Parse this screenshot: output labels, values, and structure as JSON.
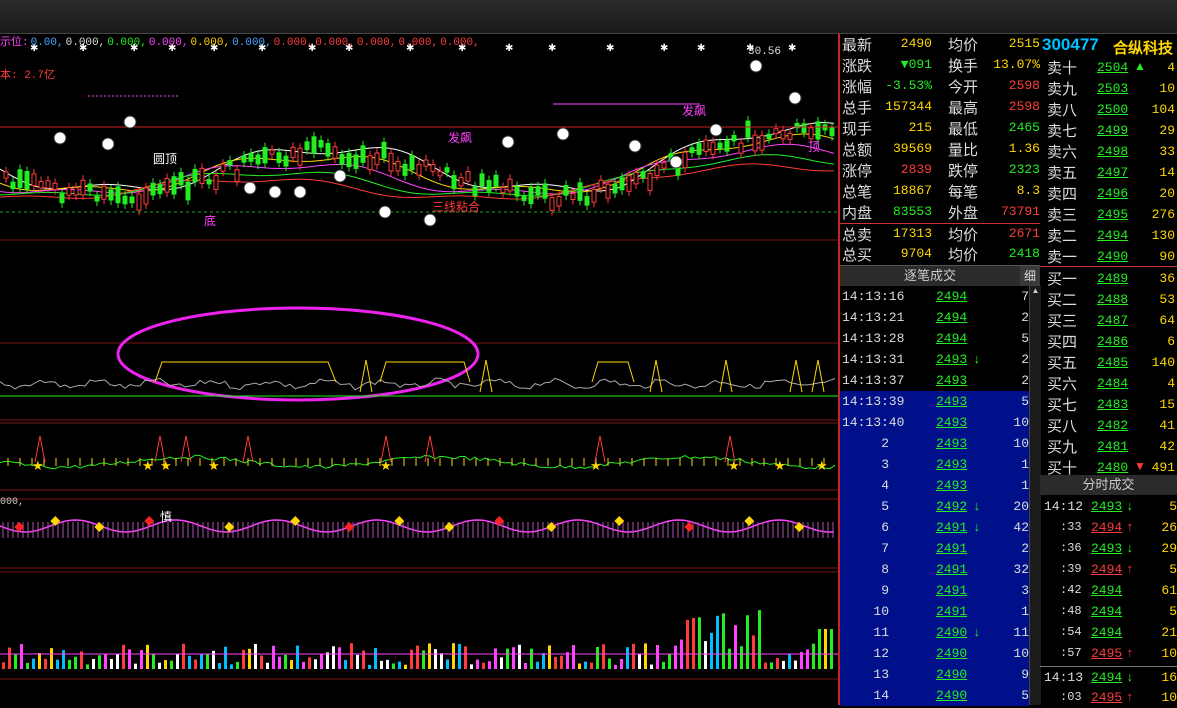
{
  "index_line": [
    {
      "t": "示位:",
      "c": "#ff44ff"
    },
    {
      "t": "0.00,",
      "c": "#4da3ff"
    },
    {
      "t": "0.000,",
      "c": "#ddd"
    },
    {
      "t": "0.000,",
      "c": "#22ee22"
    },
    {
      "t": "0.000,",
      "c": "#ff44ff"
    },
    {
      "t": "0.000,",
      "c": "#ffd700"
    },
    {
      "t": "0.000,",
      "c": "#4da3ff"
    },
    {
      "t": "0.000,",
      "c": "#ff3b3b"
    },
    {
      "t": "0.000,",
      "c": "#ff3b3b"
    },
    {
      "t": "0.000,",
      "c": "#ff3b3b"
    },
    {
      "t": "0.000,",
      "c": "#ff3b3b"
    },
    {
      "t": "0.000,",
      "c": "#ff3b3b"
    }
  ],
  "volume_label": "本: 2.7亿",
  "panel3_label": "000,",
  "price_label": "30.56",
  "annotations": [
    {
      "t": "圆顶",
      "c": "#ffffff"
    },
    {
      "t": "发飙",
      "c": "#ff44ff"
    },
    {
      "t": "发飙",
      "c": "#ff44ff"
    },
    {
      "t": "三线粘合",
      "c": "#ff3b3b"
    },
    {
      "t": "底",
      "c": "#ff44ff"
    },
    {
      "t": "顶",
      "c": "#ff44ff"
    },
    {
      "t": "慎",
      "c": "#ffffff"
    }
  ],
  "quote": {
    "rows": [
      {
        "l": "最新",
        "v": "2490",
        "vc": "#ffd700",
        "l2": "均价",
        "v2": "2515",
        "v2c": "#ffd700"
      },
      {
        "l": "涨跌",
        "v": "▼091",
        "vc": "#22ee22",
        "l2": "换手",
        "v2": "13.07%",
        "v2c": "#ffd700"
      },
      {
        "l": "涨幅",
        "v": "-3.53%",
        "vc": "#22ee22",
        "l2": "今开",
        "v2": "2598",
        "v2c": "#ff3b3b"
      },
      {
        "l": "总手",
        "v": "157344",
        "vc": "#ffd700",
        "l2": "最高",
        "v2": "2598",
        "v2c": "#ff3b3b"
      },
      {
        "l": "现手",
        "v": "215",
        "vc": "#ffd700",
        "l2": "最低",
        "v2": "2465",
        "v2c": "#22ee22"
      },
      {
        "l": "总额",
        "v": "39569",
        "vc": "#ffd700",
        "l2": "量比",
        "v2": "1.36",
        "v2c": "#ffd700"
      },
      {
        "l": "涨停",
        "v": "2839",
        "vc": "#ff3b3b",
        "l2": "跌停",
        "v2": "2323",
        "v2c": "#22ee22"
      },
      {
        "l": "总笔",
        "v": "18867",
        "vc": "#ffd700",
        "l2": "每笔",
        "v2": "8.3",
        "v2c": "#ffd700"
      },
      {
        "l": "内盘",
        "v": "83553",
        "vc": "#22ee22",
        "l2": "外盘",
        "v2": "73791",
        "v2c": "#ff3b3b"
      },
      {
        "l": "总卖",
        "v": "17313",
        "vc": "#ffd700",
        "l2": "均价",
        "v2": "2671",
        "v2c": "#ff3b3b"
      },
      {
        "l": "总买",
        "v": "9704",
        "vc": "#ffd700",
        "l2": "均价",
        "v2": "2418",
        "v2c": "#22ee22"
      }
    ]
  },
  "ticks": {
    "title": "逐笔成交",
    "btn": "细",
    "rows": [
      {
        "t": "14:13:16",
        "p": "2494",
        "pc": "#22ee22",
        "a": "",
        "v": "7"
      },
      {
        "t": "14:13:21",
        "p": "2494",
        "pc": "#22ee22",
        "a": "",
        "v": "2"
      },
      {
        "t": "14:13:28",
        "p": "2494",
        "pc": "#22ee22",
        "a": "",
        "v": "5"
      },
      {
        "t": "14:13:31",
        "p": "2493",
        "pc": "#22ee22",
        "a": "↓",
        "v": "2"
      },
      {
        "t": "14:13:37",
        "p": "2493",
        "pc": "#22ee22",
        "a": "",
        "v": "2"
      },
      {
        "t": "14:13:39",
        "p": "2493",
        "pc": "#22ee22",
        "a": "",
        "v": "5"
      },
      {
        "t": "14:13:40",
        "p": "2493",
        "pc": "#22ee22",
        "a": "",
        "v": "10"
      },
      {
        "t": "2",
        "p": "2493",
        "pc": "#22ee22",
        "a": "",
        "v": "10"
      },
      {
        "t": "3",
        "p": "2493",
        "pc": "#22ee22",
        "a": "",
        "v": "1"
      },
      {
        "t": "4",
        "p": "2493",
        "pc": "#22ee22",
        "a": "",
        "v": "1"
      },
      {
        "t": "5",
        "p": "2492",
        "pc": "#22ee22",
        "a": "↓",
        "v": "20"
      },
      {
        "t": "6",
        "p": "2491",
        "pc": "#22ee22",
        "a": "↓",
        "v": "42"
      },
      {
        "t": "7",
        "p": "2491",
        "pc": "#22ee22",
        "a": "",
        "v": "2"
      },
      {
        "t": "8",
        "p": "2491",
        "pc": "#22ee22",
        "a": "",
        "v": "32"
      },
      {
        "t": "9",
        "p": "2491",
        "pc": "#22ee22",
        "a": "",
        "v": "3"
      },
      {
        "t": "10",
        "p": "2491",
        "pc": "#22ee22",
        "a": "",
        "v": "1"
      },
      {
        "t": "11",
        "p": "2490",
        "pc": "#22ee22",
        "a": "↓",
        "v": "11"
      },
      {
        "t": "12",
        "p": "2490",
        "pc": "#22ee22",
        "a": "",
        "v": "10"
      },
      {
        "t": "13",
        "p": "2490",
        "pc": "#22ee22",
        "a": "",
        "v": "9"
      },
      {
        "t": "14",
        "p": "2490",
        "pc": "#22ee22",
        "a": "",
        "v": "5"
      }
    ]
  },
  "stock": {
    "code": "300477",
    "name": "合纵科技"
  },
  "book": [
    {
      "l": "卖十",
      "p": "2504",
      "pc": "#22ee22",
      "a": "▲",
      "v": "4"
    },
    {
      "l": "卖九",
      "p": "2503",
      "pc": "#22ee22",
      "a": "",
      "v": "10"
    },
    {
      "l": "卖八",
      "p": "2500",
      "pc": "#22ee22",
      "a": "",
      "v": "104"
    },
    {
      "l": "卖七",
      "p": "2499",
      "pc": "#22ee22",
      "a": "",
      "v": "29"
    },
    {
      "l": "卖六",
      "p": "2498",
      "pc": "#22ee22",
      "a": "",
      "v": "33"
    },
    {
      "l": "卖五",
      "p": "2497",
      "pc": "#22ee22",
      "a": "",
      "v": "14"
    },
    {
      "l": "卖四",
      "p": "2496",
      "pc": "#22ee22",
      "a": "",
      "v": "20"
    },
    {
      "l": "卖三",
      "p": "2495",
      "pc": "#22ee22",
      "a": "",
      "v": "276"
    },
    {
      "l": "卖二",
      "p": "2494",
      "pc": "#22ee22",
      "a": "",
      "v": "130"
    },
    {
      "l": "卖一",
      "p": "2490",
      "pc": "#22ee22",
      "a": "",
      "v": "90"
    },
    {
      "l": "买一",
      "p": "2489",
      "pc": "#22ee22",
      "a": "",
      "v": "36"
    },
    {
      "l": "买二",
      "p": "2488",
      "pc": "#22ee22",
      "a": "",
      "v": "53"
    },
    {
      "l": "买三",
      "p": "2487",
      "pc": "#22ee22",
      "a": "",
      "v": "64"
    },
    {
      "l": "买四",
      "p": "2486",
      "pc": "#22ee22",
      "a": "",
      "v": "6"
    },
    {
      "l": "买五",
      "p": "2485",
      "pc": "#22ee22",
      "a": "",
      "v": "140"
    },
    {
      "l": "买六",
      "p": "2484",
      "pc": "#22ee22",
      "a": "",
      "v": "4"
    },
    {
      "l": "买七",
      "p": "2483",
      "pc": "#22ee22",
      "a": "",
      "v": "15"
    },
    {
      "l": "买八",
      "p": "2482",
      "pc": "#22ee22",
      "a": "",
      "v": "41"
    },
    {
      "l": "买九",
      "p": "2481",
      "pc": "#22ee22",
      "a": "",
      "v": "42"
    },
    {
      "l": "买十",
      "p": "2480",
      "pc": "#22ee22",
      "a": "▼",
      "v": "491"
    }
  ],
  "fenshi": {
    "title": "分时成交",
    "rows": [
      {
        "t": "14:12",
        "p": "2493",
        "pc": "#22ee22",
        "a": "↓",
        "ac": "#22ee22",
        "v": "5"
      },
      {
        "t": ":33",
        "p": "2494",
        "pc": "#ff3b3b",
        "a": "↑",
        "ac": "#ff3b3b",
        "v": "26"
      },
      {
        "t": ":36",
        "p": "2493",
        "pc": "#22ee22",
        "a": "↓",
        "ac": "#22ee22",
        "v": "29"
      },
      {
        "t": ":39",
        "p": "2494",
        "pc": "#ff3b3b",
        "a": "↑",
        "ac": "#ff3b3b",
        "v": "5"
      },
      {
        "t": ":42",
        "p": "2494",
        "pc": "#22ee22",
        "a": "",
        "ac": "",
        "v": "61"
      },
      {
        "t": ":48",
        "p": "2494",
        "pc": "#22ee22",
        "a": "",
        "ac": "",
        "v": "5"
      },
      {
        "t": ":54",
        "p": "2494",
        "pc": "#22ee22",
        "a": "",
        "ac": "",
        "v": "21"
      },
      {
        "t": ":57",
        "p": "2495",
        "pc": "#ff3b3b",
        "a": "↑",
        "ac": "#ff3b3b",
        "v": "10"
      },
      {
        "t": "14:13",
        "p": "2494",
        "pc": "#22ee22",
        "a": "↓",
        "ac": "#22ee22",
        "v": "16"
      },
      {
        "t": ":03",
        "p": "2495",
        "pc": "#ff3b3b",
        "a": "↑",
        "ac": "#ff3b3b",
        "v": "10"
      }
    ]
  }
}
